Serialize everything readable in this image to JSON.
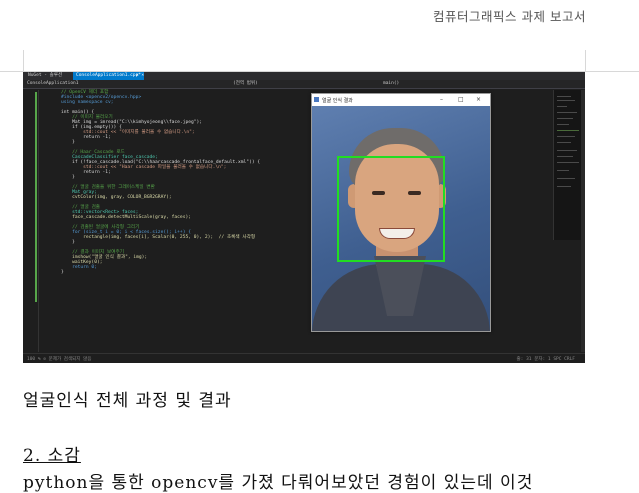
{
  "header": {
    "title": "컴퓨터그래픽스 과제 보고서"
  },
  "ide": {
    "tabs": [
      "NuGet - 솔루션",
      "ConsoleApplication1.cpp*"
    ],
    "tab_close": "× ×",
    "nav_project": "ConsoleApplication1",
    "nav_scope": "(전역 범위)",
    "nav_function": "main()",
    "status": "100 %  ⊘ 문제가 검색되지 않음",
    "status_right": "줄: 31  문자: 1  SPC  CRLF",
    "code_lines": [
      "// OpenCV 헤더 포함",
      "#include <opencv2/opencv.hpp>",
      "using namespace cv;",
      "",
      "int main() {",
      "    // 이미지 불러오기",
      "    Mat img = imread(\"C:\\\\kimhyojeong\\\\face.jpeg\");",
      "    if (img.empty()) {",
      "        std::cout << \"이미지를 불러올 수 없습니다.\\n\";",
      "        return -1;",
      "    }",
      "",
      "    // Haar Cascade 로드",
      "    CascadeClassifier face_cascade;",
      "    if (!face_cascade.load(\"C:\\\\haarcascade_frontalface_default.xml\")) {",
      "        std::cout << \"Haar cascade 파일을 불러올 수 없습니다.\\n\";",
      "        return -1;",
      "    }",
      "",
      "    // 얼굴 검출을 위한 그레이스케일 변환",
      "    Mat gray;",
      "    cvtColor(img, gray, COLOR_BGR2GRAY);",
      "",
      "    // 얼굴 검출",
      "    std::vector<Rect> faces;",
      "    face_cascade.detectMultiScale(gray, faces);",
      "",
      "    // 검출된 얼굴에 사각형 그리기",
      "    for (size_t i = 0; i < faces.size(); i++) {",
      "        rectangle(img, faces[i], Scalar(0, 255, 0), 2);  // 초록색 사각형",
      "    }",
      "",
      "    // 결과 이미지 보여주기",
      "    imshow(\"얼굴 인식 결과\", img);",
      "    waitKey(0);",
      "    return 0;",
      "}"
    ]
  },
  "result_window": {
    "title": "얼굴 인식 결과",
    "minimize": "–",
    "maximize": "□",
    "close": "×"
  },
  "document": {
    "caption": "얼굴인식 전체 과정 및 결과",
    "section_heading": "2.  소감",
    "body_start": "python을 통한 opencv를 가졌 다뤄어보았던 경험이 있는데 이것"
  }
}
